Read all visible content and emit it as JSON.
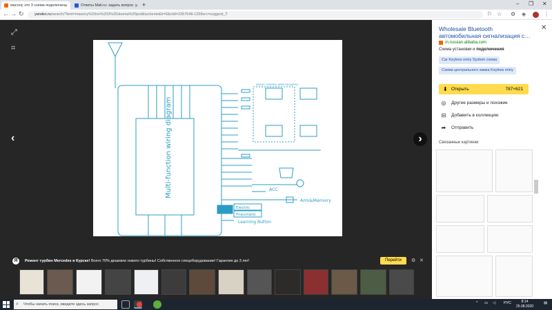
{
  "browser": {
    "tabs": [
      {
        "title": "масону это 3 схема подключен",
        "active": true,
        "fav": "#e60"
      },
      {
        "title": "Ответы Mail.ru: задать вопрос",
        "active": false,
        "fav": "#1f5bd3"
      }
    ],
    "url_host": "yandex.ru",
    "url_path": "/search/?text=masony%20no%203%20skema%20podkluchenie&lr=6&clid=2367648-1258src=suggest_T",
    "new_tab_icon": "+"
  },
  "viewer": {
    "ad": {
      "bold": "Ремонт турбин Mercedes в Курске!",
      "text": " Всего 70% дешевле нового турбины! Собственное спецоборудование! Гарантия до 3 лет!",
      "button": "Перейти"
    },
    "thumb_count": 14,
    "diagram": {
      "side_label": "Multi-function wiring diagram",
      "acc": "ACC",
      "arm": "Arm&Memory",
      "electric": "Electric",
      "pneumatic": "Pneumatic",
      "learning": "Learning Button",
      "lock_title": "SINGLE CONTROL WIRE REQUIRED"
    }
  },
  "panel": {
    "title": "Wholesale Bluetooth автомобильная сигнализация с…",
    "source": "m.russian.alibaba.com",
    "desc_plain": "Схема установки и ",
    "desc_bold": "подключения",
    "tags": [
      "Car Keyless entry System схема",
      "Схема центрального замка Keyless entry"
    ],
    "open_label": "Открыть",
    "open_size": "787×621",
    "actions": [
      {
        "icon": "camera-icon",
        "glyph": "◎",
        "label": "Другие размеры и похожие"
      },
      {
        "icon": "collection-icon",
        "glyph": "⊟",
        "label": "Добавить в коллекцию"
      },
      {
        "icon": "share-icon",
        "glyph": "➦",
        "label": "Отправить"
      }
    ],
    "related_label": "Связанные картинки"
  },
  "taskbar": {
    "search_placeholder": "Чтобы начать поиск, введите здесь запрос",
    "lang": "РУС",
    "time": "8:14",
    "date": "25.08.2020"
  },
  "colors": {
    "diagram_line": "#2b9cc4",
    "accent": "#ffdb4d",
    "link": "#1a4fb1"
  }
}
